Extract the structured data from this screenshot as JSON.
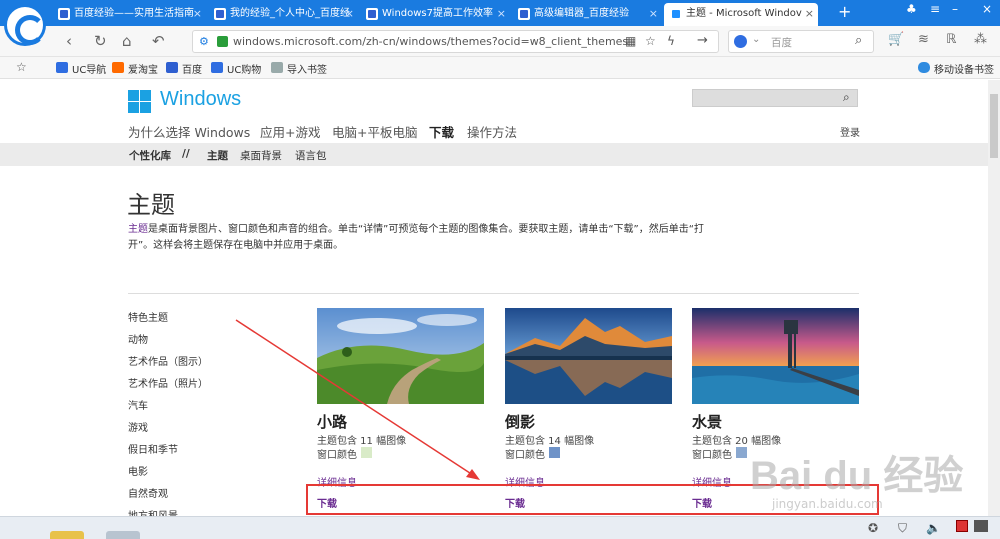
{
  "browser": {
    "tabs": [
      {
        "label": "百度经验——实用生活指南"
      },
      {
        "label": "我的经验_个人中心_百度经"
      },
      {
        "label": "Windows7提高工作效率"
      },
      {
        "label": "高级编辑器_百度经验"
      },
      {
        "label": "主题 - Microsoft Windov"
      }
    ],
    "new_tab": "+",
    "close_glyph": "×",
    "url": "windows.microsoft.com/zh-cn/windows/themes?ocid=w8_client_themes",
    "search_engine": "百度",
    "bookmarks": [
      "UC导航",
      "爱淘宝",
      "百度",
      "UC购物",
      "导入书签"
    ],
    "device_bookmarks": "移动设备书签"
  },
  "site": {
    "brand": "Windows",
    "nav": [
      "为什么选择 Windows",
      "应用+游戏",
      "电脑+平板电脑",
      "下载",
      "操作方法"
    ],
    "login": "登录",
    "subnav": [
      "个性化库",
      "//",
      "主题",
      "桌面背景",
      "语言包"
    ]
  },
  "content": {
    "title": "主题",
    "desc_keyword": "主题",
    "desc_line1": "是桌面背景图片、窗口颜色和声音的组合。单击“详情”可预览每个主题的图像集合。要获取主题，请单击“下载”，然后单击“打",
    "desc_line2": "开”。这样会将主题保存在电脑中并应用于桌面。",
    "categories": [
      "特色主题",
      "动物",
      "艺术作品（图示）",
      "艺术作品（照片）",
      "汽车",
      "游戏",
      "假日和季节",
      "电影",
      "自然奇观",
      "地方和风景"
    ],
    "themes": [
      {
        "name": "小路",
        "count": "主题包含 11 幅图像",
        "color_label": "窗口颜色",
        "color": "#d9ebc8",
        "details": "详细信息",
        "download": "下载"
      },
      {
        "name": "倒影",
        "count": "主题包含 14 幅图像",
        "color_label": "窗口颜色",
        "color": "#6f93c8",
        "details": "详细信息",
        "download": "下载"
      },
      {
        "name": "水景",
        "count": "主题包含 20 幅图像",
        "color_label": "窗口颜色",
        "color": "#8aa8d0",
        "details": "详细信息",
        "download": "下载"
      }
    ]
  },
  "watermark": {
    "main": "Bai du 经验",
    "sub": "jingyan.baidu.com"
  },
  "colors": {
    "tabbar": "#1a7be0",
    "ms_blue": "#1ba1e2",
    "highlight": "#e53935",
    "link": "#6a2c91"
  }
}
